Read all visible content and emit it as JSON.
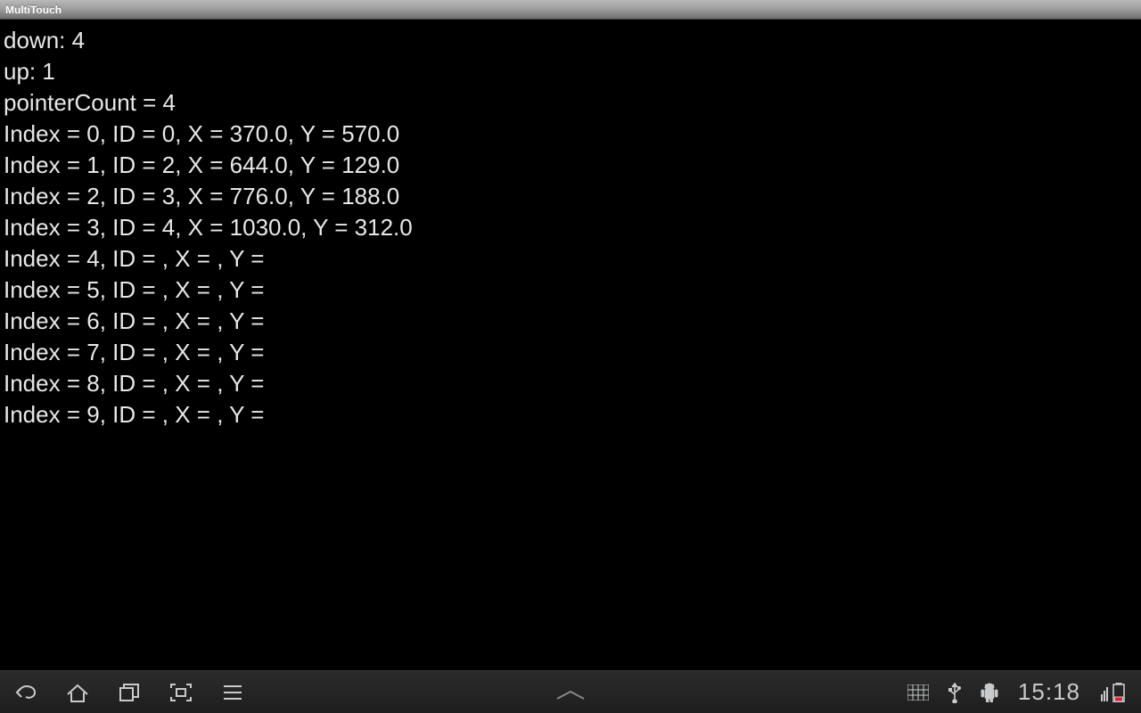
{
  "titlebar": {
    "title": "MultiTouch"
  },
  "stats": {
    "down_label": "down:",
    "down_value": "4",
    "up_label": "up:",
    "up_value": "1",
    "pointerCount_label": "pointerCount =",
    "pointerCount_value": "4"
  },
  "pointers": [
    {
      "index": "0",
      "id": "0",
      "x": "370.0",
      "y": "570.0"
    },
    {
      "index": "1",
      "id": "2",
      "x": "644.0",
      "y": "129.0"
    },
    {
      "index": "2",
      "id": "3",
      "x": "776.0",
      "y": "188.0"
    },
    {
      "index": "3",
      "id": "4",
      "x": "1030.0",
      "y": "312.0"
    },
    {
      "index": "4",
      "id": "",
      "x": "",
      "y": ""
    },
    {
      "index": "5",
      "id": "",
      "x": "",
      "y": ""
    },
    {
      "index": "6",
      "id": "",
      "x": "",
      "y": ""
    },
    {
      "index": "7",
      "id": "",
      "x": "",
      "y": ""
    },
    {
      "index": "8",
      "id": "",
      "x": "",
      "y": ""
    },
    {
      "index": "9",
      "id": "",
      "x": "",
      "y": ""
    }
  ],
  "labels": {
    "index": "Index",
    "id": "ID",
    "x": "X",
    "y": "Y",
    "eq": "=",
    "sep": ","
  },
  "navbar": {
    "clock": "15:18"
  }
}
